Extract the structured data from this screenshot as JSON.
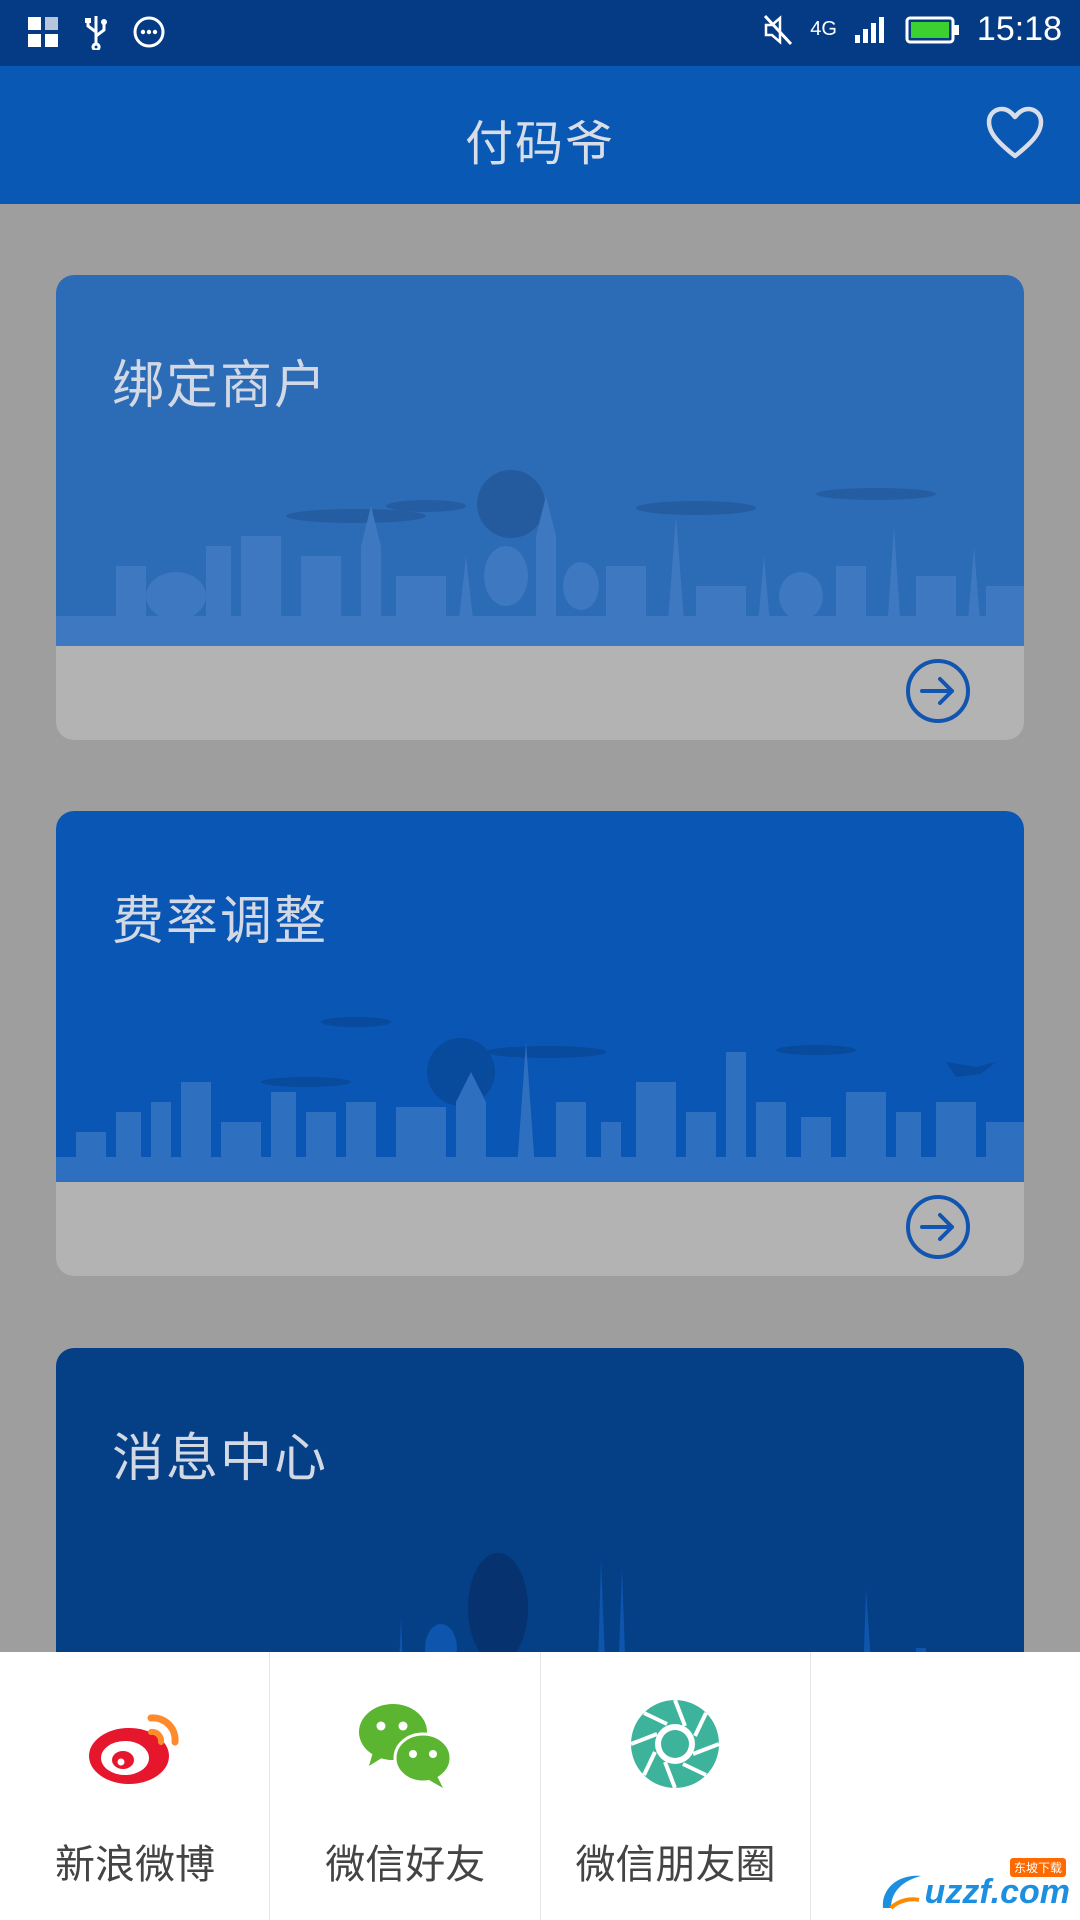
{
  "status_bar": {
    "network": "4G",
    "time": "15:18"
  },
  "app_bar": {
    "title": "付码爷",
    "favorite_icon": "heart-outline-icon"
  },
  "cards": [
    {
      "title": "绑定商户",
      "color": "#2c6bb6",
      "action_icon": "arrow-right-circle-icon"
    },
    {
      "title": "费率调整",
      "color": "#0a56b4",
      "action_icon": "arrow-right-circle-icon"
    },
    {
      "title": "消息中心",
      "color": "#053f86"
    }
  ],
  "share_sheet": {
    "items": [
      {
        "label": "新浪微博",
        "icon": "weibo-icon",
        "color": "#e6162d"
      },
      {
        "label": "微信好友",
        "icon": "wechat-icon",
        "color": "#5cb531"
      },
      {
        "label": "微信朋友圈",
        "icon": "moments-icon",
        "color": "#3db39c"
      }
    ]
  },
  "watermark": {
    "text": "uzzf.com",
    "subtext": "东坡下载"
  }
}
